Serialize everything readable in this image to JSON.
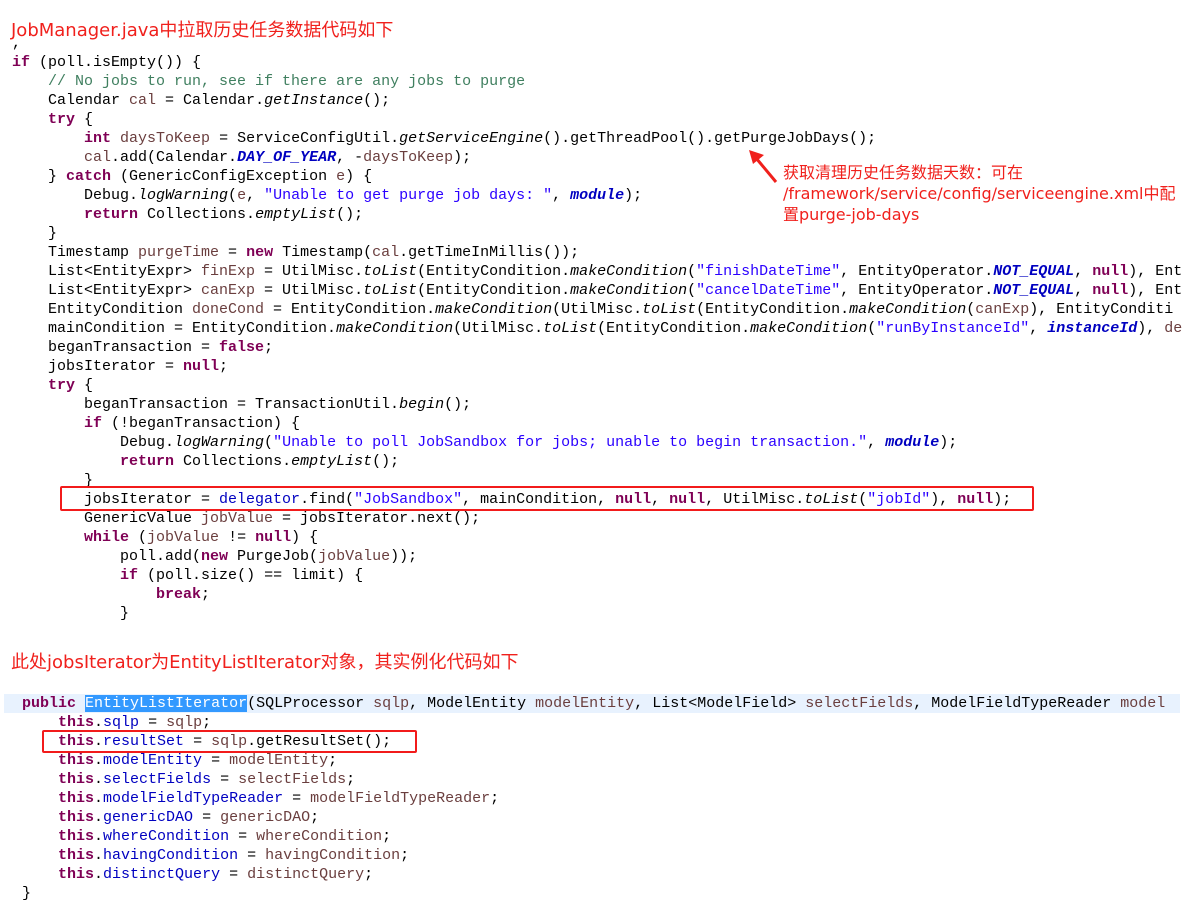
{
  "headings": {
    "first": "JobManager.java中拉取历史任务数据代码如下",
    "second": "此处jobsIterator为EntityListIterator对象，其实例化代码如下"
  },
  "annotation": {
    "lines": [
      "获取清理历史任务数据天数：可在",
      "/framework/service/config/serviceengine.xml中配",
      "置purge-job-days"
    ]
  },
  "colors": {
    "annotation": "#f0201c",
    "keyword": "#7f0055",
    "string": "#2a00ff",
    "comment": "#3f7f5f",
    "field": "#0000c0",
    "local_var": "#6a3e3e",
    "selection": "#3399ff",
    "current_line": "#e8f2fe"
  },
  "code_block_1": [
    [
      [
        "p",
        ","
      ]
    ],
    [
      [
        "k",
        "if"
      ],
      [
        "p",
        " (poll.isEmpty()) {"
      ]
    ],
    [
      [
        "p",
        "    "
      ],
      [
        "c",
        "// No jobs to run, see if there are any jobs to purge"
      ]
    ],
    [
      [
        "p",
        "    Calendar "
      ],
      [
        "v",
        "cal"
      ],
      [
        "p",
        " = Calendar."
      ],
      [
        "i",
        "getInstance"
      ],
      [
        "p",
        "();"
      ]
    ],
    [
      [
        "p",
        "    "
      ],
      [
        "k",
        "try"
      ],
      [
        "p",
        " {"
      ]
    ],
    [
      [
        "p",
        "        "
      ],
      [
        "k",
        "int"
      ],
      [
        "p",
        " "
      ],
      [
        "v",
        "daysToKeep"
      ],
      [
        "p",
        " = ServiceConfigUtil."
      ],
      [
        "i",
        "getServiceEngine"
      ],
      [
        "p",
        "().getThreadPool().getPurgeJobDays();"
      ]
    ],
    [
      [
        "p",
        "        "
      ],
      [
        "v",
        "cal"
      ],
      [
        "p",
        ".add(Calendar."
      ],
      [
        "sf",
        "DAY_OF_YEAR"
      ],
      [
        "p",
        ", -"
      ],
      [
        "v",
        "daysToKeep"
      ],
      [
        "p",
        ");"
      ]
    ],
    [
      [
        "p",
        "    } "
      ],
      [
        "k",
        "catch"
      ],
      [
        "p",
        " (GenericConfigException "
      ],
      [
        "v",
        "e"
      ],
      [
        "p",
        ") {"
      ]
    ],
    [
      [
        "p",
        "        Debug."
      ],
      [
        "i",
        "logWarning"
      ],
      [
        "p",
        "("
      ],
      [
        "v",
        "e"
      ],
      [
        "p",
        ", "
      ],
      [
        "s",
        "\"Unable to get purge job days: \""
      ],
      [
        "p",
        ", "
      ],
      [
        "sf",
        "module"
      ],
      [
        "p",
        ");"
      ]
    ],
    [
      [
        "p",
        "        "
      ],
      [
        "k",
        "return"
      ],
      [
        "p",
        " Collections."
      ],
      [
        "i",
        "emptyList"
      ],
      [
        "p",
        "();"
      ]
    ],
    [
      [
        "p",
        "    }"
      ]
    ],
    [
      [
        "p",
        "    Timestamp "
      ],
      [
        "v",
        "purgeTime"
      ],
      [
        "p",
        " = "
      ],
      [
        "k",
        "new"
      ],
      [
        "p",
        " Timestamp("
      ],
      [
        "v",
        "cal"
      ],
      [
        "p",
        ".getTimeInMillis());"
      ]
    ],
    [
      [
        "p",
        "    List<EntityExpr> "
      ],
      [
        "v",
        "finExp"
      ],
      [
        "p",
        " = UtilMisc."
      ],
      [
        "i",
        "toList"
      ],
      [
        "p",
        "(EntityCondition."
      ],
      [
        "i",
        "makeCondition"
      ],
      [
        "p",
        "("
      ],
      [
        "s",
        "\"finishDateTime\""
      ],
      [
        "p",
        ", EntityOperator."
      ],
      [
        "sf",
        "NOT_EQUAL"
      ],
      [
        "p",
        ", "
      ],
      [
        "k",
        "null"
      ],
      [
        "p",
        "), Ent"
      ]
    ],
    [
      [
        "p",
        "    List<EntityExpr> "
      ],
      [
        "v",
        "canExp"
      ],
      [
        "p",
        " = UtilMisc."
      ],
      [
        "i",
        "toList"
      ],
      [
        "p",
        "(EntityCondition."
      ],
      [
        "i",
        "makeCondition"
      ],
      [
        "p",
        "("
      ],
      [
        "s",
        "\"cancelDateTime\""
      ],
      [
        "p",
        ", EntityOperator."
      ],
      [
        "sf",
        "NOT_EQUAL"
      ],
      [
        "p",
        ", "
      ],
      [
        "k",
        "null"
      ],
      [
        "p",
        "), Ent"
      ]
    ],
    [
      [
        "p",
        "    EntityCondition "
      ],
      [
        "v",
        "doneCond"
      ],
      [
        "p",
        " = EntityCondition."
      ],
      [
        "i",
        "makeCondition"
      ],
      [
        "p",
        "(UtilMisc."
      ],
      [
        "i",
        "toList"
      ],
      [
        "p",
        "(EntityCondition."
      ],
      [
        "i",
        "makeCondition"
      ],
      [
        "p",
        "("
      ],
      [
        "v",
        "canExp"
      ],
      [
        "p",
        "), EntityConditi"
      ]
    ],
    [
      [
        "p",
        "    mainCondition = EntityCondition."
      ],
      [
        "i",
        "makeCondition"
      ],
      [
        "p",
        "(UtilMisc."
      ],
      [
        "i",
        "toList"
      ],
      [
        "p",
        "(EntityCondition."
      ],
      [
        "i",
        "makeCondition"
      ],
      [
        "p",
        "("
      ],
      [
        "s",
        "\"runByInstanceId\""
      ],
      [
        "p",
        ", "
      ],
      [
        "sf",
        "instanceId"
      ],
      [
        "p",
        "), "
      ],
      [
        "v",
        "de"
      ]
    ],
    [
      [
        "p",
        "    beganTransaction = "
      ],
      [
        "k",
        "false"
      ],
      [
        "p",
        ";"
      ]
    ],
    [
      [
        "p",
        "    jobsIterator = "
      ],
      [
        "k",
        "null"
      ],
      [
        "p",
        ";"
      ]
    ],
    [
      [
        "p",
        "    "
      ],
      [
        "k",
        "try"
      ],
      [
        "p",
        " {"
      ]
    ],
    [
      [
        "p",
        "        beganTransaction = TransactionUtil."
      ],
      [
        "i",
        "begin"
      ],
      [
        "p",
        "();"
      ]
    ],
    [
      [
        "p",
        "        "
      ],
      [
        "k",
        "if"
      ],
      [
        "p",
        " (!beganTransaction) {"
      ]
    ],
    [
      [
        "p",
        "            Debug."
      ],
      [
        "i",
        "logWarning"
      ],
      [
        "p",
        "("
      ],
      [
        "s",
        "\"Unable to poll JobSandbox for jobs; unable to begin transaction.\""
      ],
      [
        "p",
        ", "
      ],
      [
        "sf",
        "module"
      ],
      [
        "p",
        ");"
      ]
    ],
    [
      [
        "p",
        "            "
      ],
      [
        "k",
        "return"
      ],
      [
        "p",
        " Collections."
      ],
      [
        "i",
        "emptyList"
      ],
      [
        "p",
        "();"
      ]
    ],
    [
      [
        "p",
        "        }"
      ]
    ],
    [
      [
        "p",
        "        jobsIterator = "
      ],
      [
        "f",
        "delegator"
      ],
      [
        "p",
        ".find("
      ],
      [
        "s",
        "\"JobSandbox\""
      ],
      [
        "p",
        ", mainCondition, "
      ],
      [
        "k",
        "null"
      ],
      [
        "p",
        ", "
      ],
      [
        "k",
        "null"
      ],
      [
        "p",
        ", UtilMisc."
      ],
      [
        "i",
        "toList"
      ],
      [
        "p",
        "("
      ],
      [
        "s",
        "\"jobId\""
      ],
      [
        "p",
        "), "
      ],
      [
        "k",
        "null"
      ],
      [
        "p",
        ");"
      ]
    ],
    [
      [
        "p",
        "        GenericValue "
      ],
      [
        "v",
        "jobValue"
      ],
      [
        "p",
        " = jobsIterator.next();"
      ]
    ],
    [
      [
        "p",
        "        "
      ],
      [
        "k",
        "while"
      ],
      [
        "p",
        " ("
      ],
      [
        "v",
        "jobValue"
      ],
      [
        "p",
        " != "
      ],
      [
        "k",
        "null"
      ],
      [
        "p",
        ") {"
      ]
    ],
    [
      [
        "p",
        "            poll.add("
      ],
      [
        "k",
        "new"
      ],
      [
        "p",
        " PurgeJob("
      ],
      [
        "v",
        "jobValue"
      ],
      [
        "p",
        "));"
      ]
    ],
    [
      [
        "p",
        "            "
      ],
      [
        "k",
        "if"
      ],
      [
        "p",
        " (poll.size() == limit) {"
      ]
    ],
    [
      [
        "p",
        "                "
      ],
      [
        "k",
        "break"
      ],
      [
        "p",
        ";"
      ]
    ],
    [
      [
        "p",
        "            }"
      ]
    ]
  ],
  "code_block_2": [
    [
      [
        "p",
        "  "
      ],
      [
        "k",
        "public"
      ],
      [
        "p",
        " "
      ],
      [
        "sel",
        "EntityListIterator"
      ],
      [
        "p",
        "(SQLProcessor "
      ],
      [
        "v",
        "sqlp"
      ],
      [
        "p",
        ", ModelEntity "
      ],
      [
        "v",
        "modelEntity"
      ],
      [
        "p",
        ", List<ModelField> "
      ],
      [
        "v",
        "selectFields"
      ],
      [
        "p",
        ", ModelFieldTypeReader "
      ],
      [
        "v",
        "model"
      ]
    ],
    [
      [
        "p",
        "      "
      ],
      [
        "k",
        "this"
      ],
      [
        "p",
        "."
      ],
      [
        "f",
        "sqlp"
      ],
      [
        "p",
        " = "
      ],
      [
        "v",
        "sqlp"
      ],
      [
        "p",
        ";"
      ]
    ],
    [
      [
        "p",
        "      "
      ],
      [
        "k",
        "this"
      ],
      [
        "p",
        "."
      ],
      [
        "f",
        "resultSet"
      ],
      [
        "p",
        " = "
      ],
      [
        "v",
        "sqlp"
      ],
      [
        "p",
        ".getResultSet();"
      ]
    ],
    [
      [
        "p",
        "      "
      ],
      [
        "k",
        "this"
      ],
      [
        "p",
        "."
      ],
      [
        "f",
        "modelEntity"
      ],
      [
        "p",
        " = "
      ],
      [
        "v",
        "modelEntity"
      ],
      [
        "p",
        ";"
      ]
    ],
    [
      [
        "p",
        "      "
      ],
      [
        "k",
        "this"
      ],
      [
        "p",
        "."
      ],
      [
        "f",
        "selectFields"
      ],
      [
        "p",
        " = "
      ],
      [
        "v",
        "selectFields"
      ],
      [
        "p",
        ";"
      ]
    ],
    [
      [
        "p",
        "      "
      ],
      [
        "k",
        "this"
      ],
      [
        "p",
        "."
      ],
      [
        "f",
        "modelFieldTypeReader"
      ],
      [
        "p",
        " = "
      ],
      [
        "v",
        "modelFieldTypeReader"
      ],
      [
        "p",
        ";"
      ]
    ],
    [
      [
        "p",
        "      "
      ],
      [
        "k",
        "this"
      ],
      [
        "p",
        "."
      ],
      [
        "f",
        "genericDAO"
      ],
      [
        "p",
        " = "
      ],
      [
        "v",
        "genericDAO"
      ],
      [
        "p",
        ";"
      ]
    ],
    [
      [
        "p",
        "      "
      ],
      [
        "k",
        "this"
      ],
      [
        "p",
        "."
      ],
      [
        "f",
        "whereCondition"
      ],
      [
        "p",
        " = "
      ],
      [
        "v",
        "whereCondition"
      ],
      [
        "p",
        ";"
      ]
    ],
    [
      [
        "p",
        "      "
      ],
      [
        "k",
        "this"
      ],
      [
        "p",
        "."
      ],
      [
        "f",
        "havingCondition"
      ],
      [
        "p",
        " = "
      ],
      [
        "v",
        "havingCondition"
      ],
      [
        "p",
        ";"
      ]
    ],
    [
      [
        "p",
        "      "
      ],
      [
        "k",
        "this"
      ],
      [
        "p",
        "."
      ],
      [
        "f",
        "distinctQuery"
      ],
      [
        "p",
        " = "
      ],
      [
        "v",
        "distinctQuery"
      ],
      [
        "p",
        ";"
      ]
    ],
    [
      [
        "p",
        "  }"
      ]
    ]
  ]
}
